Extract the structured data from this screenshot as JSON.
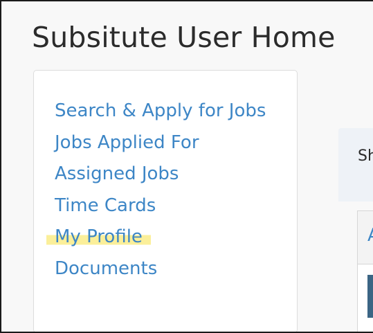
{
  "page_title": "Subsitute User Home",
  "sidebar": {
    "items": [
      {
        "label": "Search & Apply for Jobs",
        "highlighted": false
      },
      {
        "label": "Jobs Applied For",
        "highlighted": false
      },
      {
        "label": "Assigned Jobs",
        "highlighted": false
      },
      {
        "label": "Time Cards",
        "highlighted": false
      },
      {
        "label": "My Profile",
        "highlighted": true
      },
      {
        "label": "Documents",
        "highlighted": false
      }
    ]
  },
  "right_panel": {
    "partial_text": "Sh"
  },
  "table": {
    "partial_header": "A"
  },
  "colors": {
    "link": "#3d86c6",
    "highlight": "#fbef9a",
    "title": "#2b2b2b",
    "table_block": "#3b6584"
  }
}
